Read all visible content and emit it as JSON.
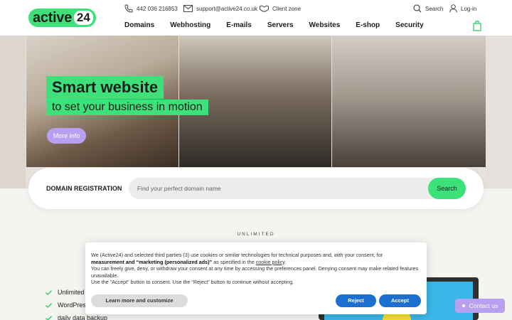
{
  "header": {
    "logo_text": "active",
    "logo_num": "24",
    "phone": "442 036 216853",
    "email": "support@active24.co.uk",
    "client_zone": "Client zone",
    "search": "Search",
    "login": "Log-in",
    "nav": [
      "Domains",
      "Webhosting",
      "E-mails",
      "Servers",
      "Websites",
      "E-shop",
      "Security"
    ]
  },
  "hero": {
    "title": "Smart website",
    "subtitle": "to set your business in motion",
    "more_info": "More info"
  },
  "domain": {
    "label": "DOMAIN REGISTRATION",
    "placeholder": "Find your perfect domain name",
    "search_button": "Search"
  },
  "section": {
    "eyebrow": "UNLIMITED",
    "features": [
      "Unlimited w",
      "WordPress",
      "daily data backup"
    ]
  },
  "cookie": {
    "line1": "We (Active24) and selected third parties (3) use cookies or similar technologies for technical purposes and, with your consent, for",
    "line2_bold": "measurement and “marketing (personalized ads)”",
    "line2_rest": " as specified in the ",
    "link": "cookie policy",
    "line2_end": ".",
    "line3": "You can freely give, deny, or withdraw your consent at any time by accessing the preferences panel. Denying consent may make related features unavailable.",
    "line4": "Use the “Accept” button to consent. Use the “Reject” button to continue without accepting.",
    "learn_more": "Learn more and customize",
    "reject": "Reject",
    "accept": "Accept"
  },
  "contact": "Contact us",
  "colors": {
    "brand_green": "#3ee07a",
    "accent_purple": "#b89ff0",
    "button_blue": "#1a6fd0"
  }
}
